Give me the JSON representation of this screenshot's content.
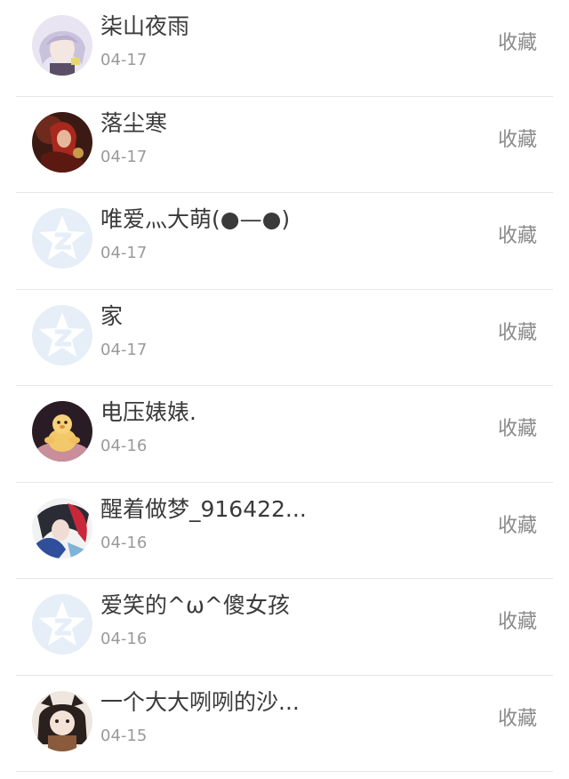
{
  "follow_list": {
    "action_label": "收藏",
    "items": [
      {
        "name": "柒山夜雨",
        "date": "04-17",
        "avatar": "anime-avatar-lilac"
      },
      {
        "name": "落尘寒",
        "date": "04-17",
        "avatar": "anime-avatar-red"
      },
      {
        "name": "唯爱灬大萌(●—●)",
        "date": "04-17",
        "avatar": "default-star-avatar"
      },
      {
        "name": "家",
        "date": "04-17",
        "avatar": "default-star-avatar"
      },
      {
        "name": "电压婊婊.",
        "date": "04-16",
        "avatar": "duck-toy-avatar"
      },
      {
        "name": "醒着做梦_916422...",
        "date": "04-16",
        "avatar": "anime-avatar-dark"
      },
      {
        "name": "爱笑的^ω^傻女孩",
        "date": "04-16",
        "avatar": "default-star-avatar"
      },
      {
        "name": "一个大大咧咧的沙...",
        "date": "04-15",
        "avatar": "anime-avatar-girl"
      }
    ]
  }
}
